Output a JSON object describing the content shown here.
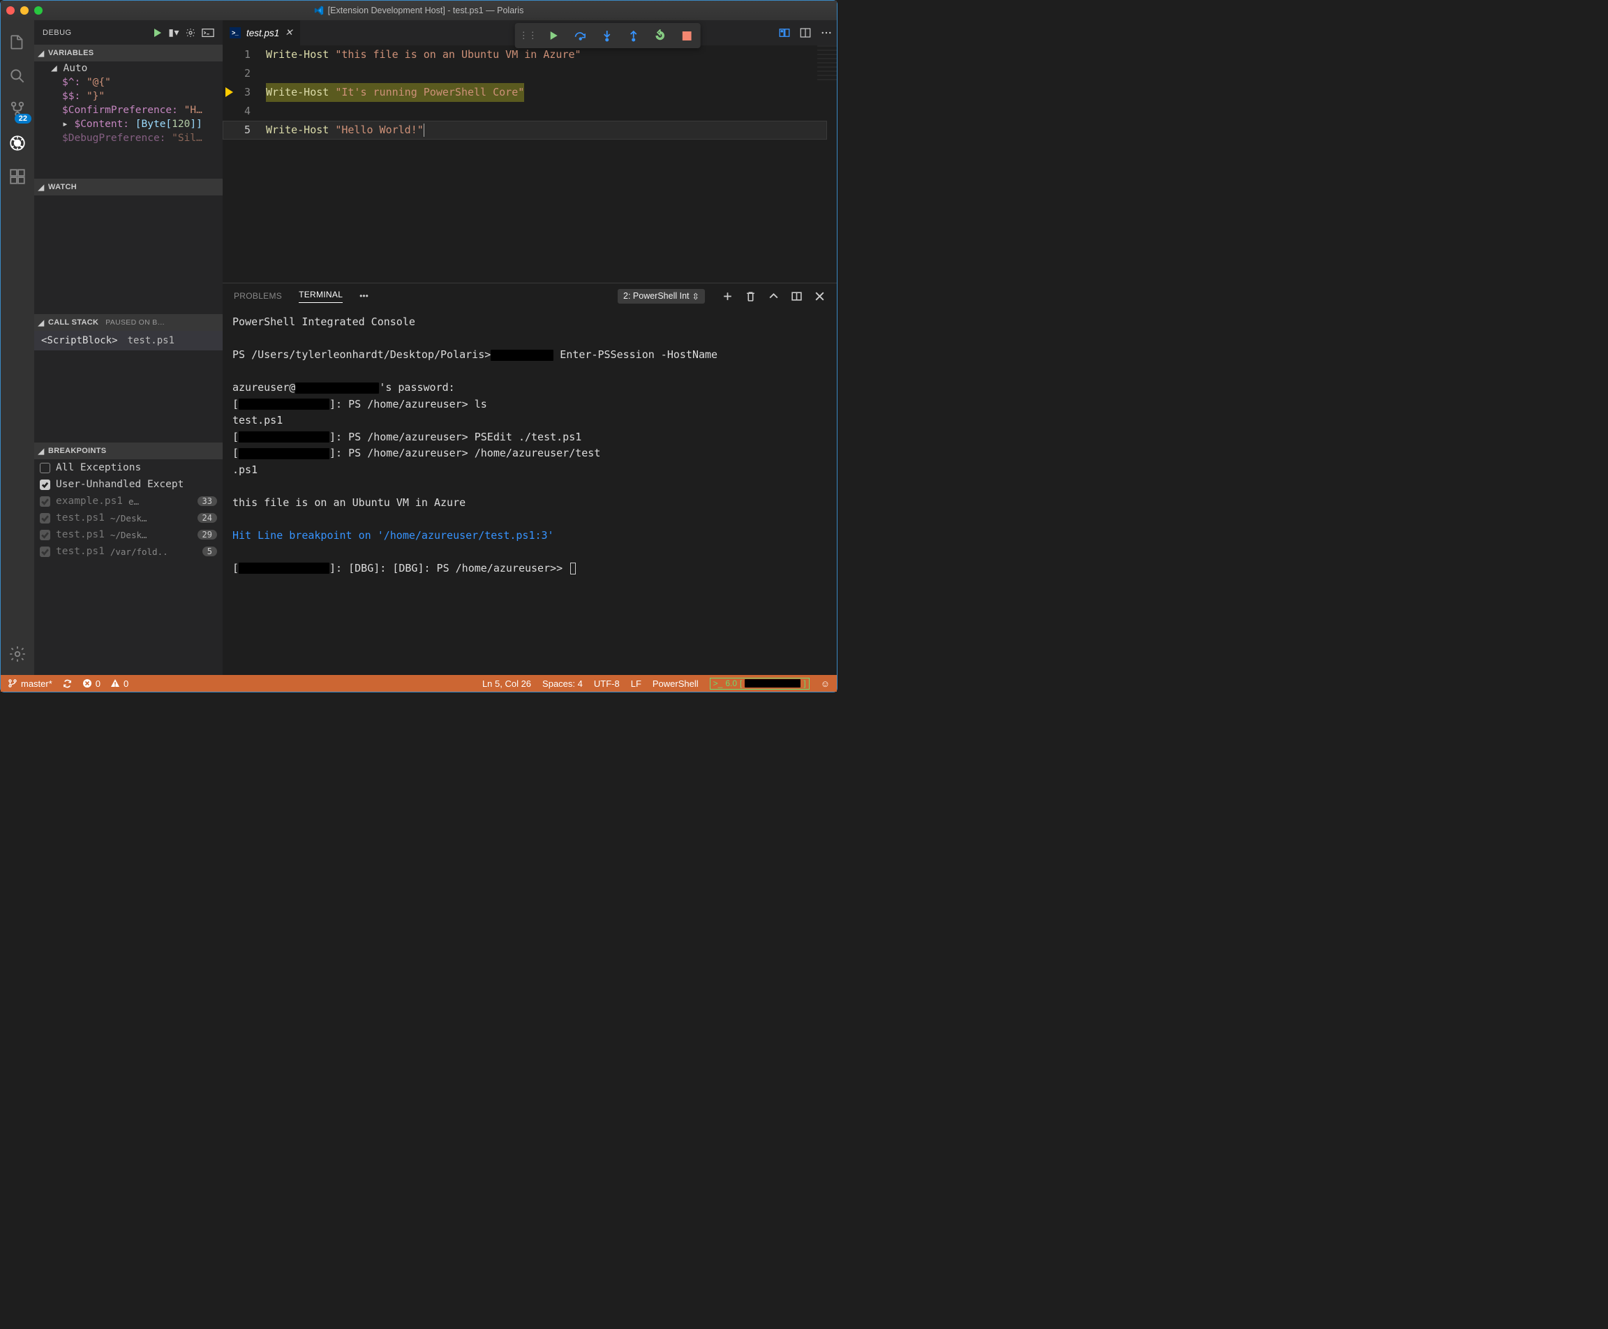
{
  "window": {
    "title": "[Extension Development Host] - test.ps1 — Polaris"
  },
  "activitybar": {
    "scm_badge": "22"
  },
  "sidebar": {
    "title": "DEBUG",
    "sections": {
      "variables": {
        "label": "VARIABLES",
        "auto_label": "Auto",
        "rows": [
          {
            "name": "$^:",
            "val": "\"@{\""
          },
          {
            "name": "$$:",
            "val": "\"}\""
          },
          {
            "name": "$ConfirmPreference:",
            "val": "\"H…"
          },
          {
            "name": "$Content:",
            "type": "[Byte[",
            "num": "120",
            "type2": "]]",
            "expander": "▸"
          },
          {
            "name": "$DebugPreference:",
            "val": "\"Sil…",
            "cut": true
          }
        ]
      },
      "watch": {
        "label": "WATCH"
      },
      "callstack": {
        "label": "CALL STACK",
        "status": "PAUSED ON B…",
        "rows": [
          {
            "name": "<ScriptBlock>",
            "file": "test.ps1"
          }
        ]
      },
      "breakpoints": {
        "label": "BREAKPOINTS",
        "rows": [
          {
            "checked": false,
            "label": "All Exceptions"
          },
          {
            "checked": true,
            "label": "User-Unhandled Except"
          },
          {
            "disabled": true,
            "label": "example.ps1",
            "path": "e…",
            "line": "33"
          },
          {
            "disabled": true,
            "label": "test.ps1",
            "path": "~/Desk…",
            "line": "24"
          },
          {
            "disabled": true,
            "label": "test.ps1",
            "path": "~/Desk…",
            "line": "29"
          },
          {
            "disabled": true,
            "label": "test.ps1",
            "path": "/var/fold..",
            "line": "5"
          }
        ]
      }
    }
  },
  "tabs": {
    "file": "test.ps1"
  },
  "editor": {
    "lines": [
      {
        "n": "1",
        "cmd": "Write-Host",
        "str": "\"this file is on an Ubuntu VM in Azure\""
      },
      {
        "n": "2"
      },
      {
        "n": "3",
        "cmd": "Write-Host",
        "str": "\"It's running PowerShell Core\"",
        "hl": true,
        "arrow": true
      },
      {
        "n": "4"
      },
      {
        "n": "5",
        "cmd": "Write-Host",
        "str": "\"Hello World!\"",
        "current": true
      }
    ]
  },
  "panel": {
    "tabs": {
      "problems": "PROBLEMS",
      "terminal": "TERMINAL"
    },
    "term_select": "2: PowerShell Int",
    "terminal_lines": [
      "PowerShell Integrated Console",
      "",
      {
        "prompt": "PS /Users/tylerleonhardt/Desktop/Polaris>",
        "cmd": " Enter-PSSession -HostName ",
        "redact": 90
      },
      "",
      {
        "pre": "azureuser@",
        "redact": 120,
        "post": "'s password:"
      },
      {
        "pre": "[",
        "redact": 130,
        "post": "]: PS /home/azureuser> ls"
      },
      "test.ps1",
      {
        "pre": "[",
        "redact": 130,
        "post": "]: PS /home/azureuser> PSEdit ./test.ps1"
      },
      {
        "pre": "[",
        "redact": 130,
        "post": "]: PS /home/azureuser> /home/azureuser/test"
      },
      ".ps1",
      "",
      "this file is on an Ubuntu VM in Azure",
      "",
      {
        "blue": "Hit Line breakpoint on '/home/azureuser/test.ps1:3'"
      },
      "",
      {
        "pre": "[",
        "redact": 130,
        "post": "]: [DBG]: [DBG]: PS /home/azureuser>> ",
        "cursor": true
      }
    ]
  },
  "statusbar": {
    "branch": "master*",
    "errors": "0",
    "warnings": "0",
    "pos": "Ln 5, Col 26",
    "spaces": "Spaces: 4",
    "enc": "UTF-8",
    "eol": "LF",
    "lang": "PowerShell",
    "psver": "6.0"
  }
}
